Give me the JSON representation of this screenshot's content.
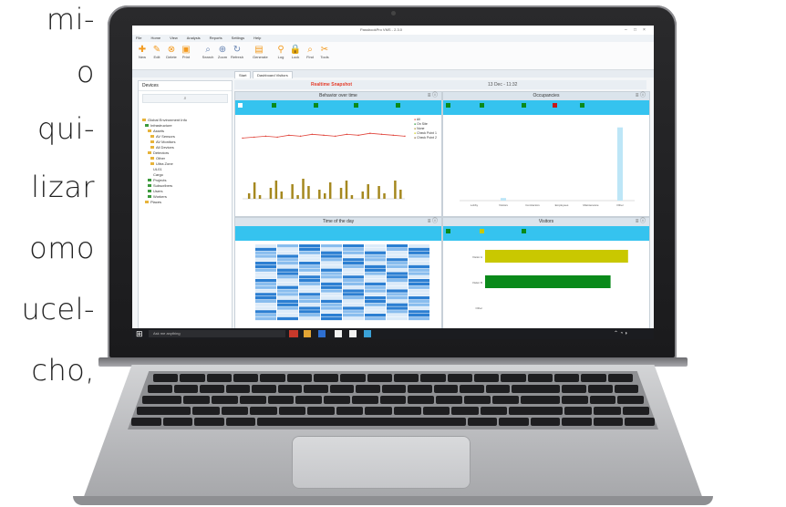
{
  "side_text": [
    "mi-",
    "o",
    "qui-",
    "lizar",
    "omo",
    "ucel-",
    "cho,"
  ],
  "app": {
    "window_title": "PassbookPro VMS - 2.3.0",
    "menu": [
      "File",
      "Home",
      "View",
      "Analysis",
      "Reports",
      "Settings",
      "Help"
    ],
    "ribbon_buttons": [
      "New",
      "Edit",
      "Delete",
      "Print",
      "Search",
      "Zoom",
      "Refresh",
      "Generate",
      "Log",
      "Lock",
      "Find",
      "Tools"
    ],
    "tabs": [
      "Start",
      "Dashboard Visitors"
    ],
    "chart_header": "Realtime Snapshot",
    "date_header": "13 Dec - 11:32"
  },
  "sidebar": {
    "title": "Devices",
    "tree": [
      "Global Environment Info",
      "Infrastructure",
      "Assets",
      "AV Sensors",
      "AV Monitors",
      "All Devices",
      "Detectors",
      "Other",
      "Ultra Zone",
      "UL01",
      "Cargo",
      "Projects",
      "Subscribers",
      "Users",
      "Workers",
      "Places"
    ]
  },
  "panels": {
    "top_left": {
      "title": "Behavior over time",
      "legend": [
        "All",
        "On Site",
        "None",
        "Check Point 1",
        "Check Point 2"
      ]
    },
    "top_right": {
      "title": "Occupancies"
    },
    "bottom_left": {
      "title": "Time of the day"
    },
    "bottom_right": {
      "title": "Visitors"
    }
  },
  "taskbar": {
    "search_placeholder": "Ask me anything"
  },
  "colors": {
    "accent": "#35c3ef",
    "line": "#e0433a",
    "bars": "#a5881f",
    "yellow_bar": "#c9c800",
    "green_bar": "#0a8a1a",
    "heat": "#2c7fd2"
  },
  "chart_data": [
    {
      "type": "line",
      "title": "Behavior over time",
      "series": [
        {
          "name": "All",
          "values": [
            14,
            15,
            16,
            15,
            17,
            16,
            18,
            17,
            16,
            18,
            17,
            19,
            18,
            17,
            16
          ]
        }
      ]
    },
    {
      "type": "bar",
      "title": "Occupancies",
      "categories": [
        "Lobby",
        "Visitors",
        "Contractors",
        "Employees",
        "Maintenance",
        "Other"
      ],
      "values": [
        0,
        1,
        0,
        0,
        0,
        28
      ]
    },
    {
      "type": "bar",
      "title": "Visitors",
      "categories": [
        "Visitor A",
        "Visitor B",
        "Other"
      ],
      "values": [
        98,
        86,
        0
      ]
    }
  ]
}
